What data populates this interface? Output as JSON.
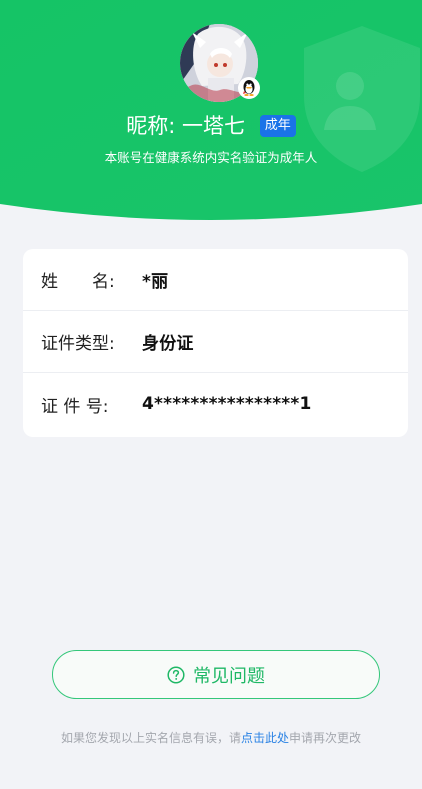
{
  "header": {
    "nickname_label": "昵称:",
    "nickname": "一塔七",
    "age_badge": "成年",
    "verify_text": "本账号在健康系统内实名验证为成年人",
    "avatar_icon": "avatar-image",
    "qq_icon": "qq-penguin-icon",
    "shield_icon": "shield-person-icon",
    "accent_color": "#16c465"
  },
  "info": {
    "rows": [
      {
        "label": "姓　　名:",
        "value": "*丽"
      },
      {
        "label": "证件类型:",
        "value": "身份证"
      },
      {
        "label": "证 件 号:",
        "value": "4****************1"
      }
    ]
  },
  "faq": {
    "label": "常见问题",
    "icon": "question-circle-icon"
  },
  "footer": {
    "prefix": "如果您发现以上实名信息有误，请",
    "link": "点击此处",
    "suffix": "申请再次更改"
  }
}
